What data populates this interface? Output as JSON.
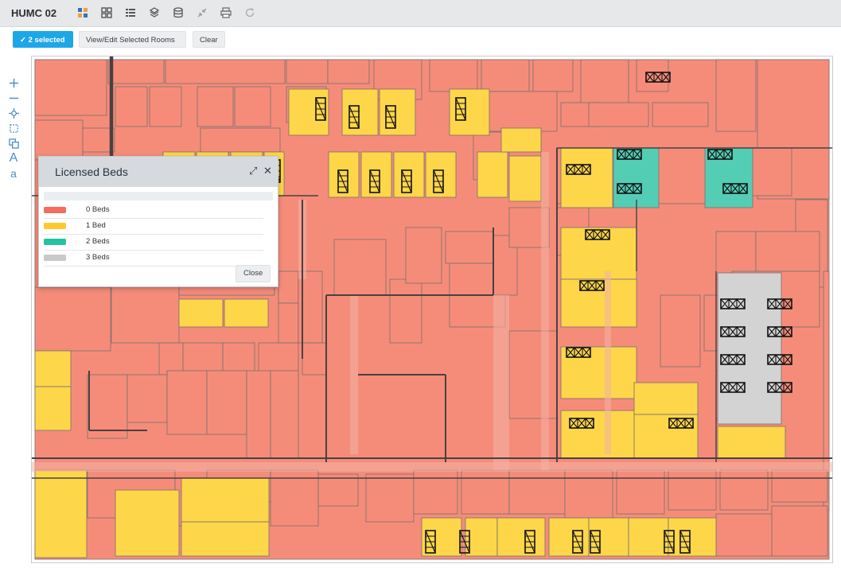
{
  "header": {
    "title": "HUMC 02"
  },
  "toolbar": {
    "icons": [
      "grid-color-icon",
      "grid-icon",
      "list-icon",
      "layers-icon",
      "stack-icon",
      "collapse-icon",
      "print-icon",
      "refresh-icon"
    ]
  },
  "actions": {
    "selected_label": "2 selected",
    "view_edit_label": "View/Edit Selected Rooms",
    "clear_label": "Clear"
  },
  "map_tools": [
    "zoom-in",
    "zoom-out",
    "pan",
    "select-area",
    "copy",
    "text-large",
    "text-small"
  ],
  "map_tool_glyphs": {
    "text_large": "A",
    "text_small": "a"
  },
  "legend": {
    "title": "Licensed Beds",
    "close_label": "Close",
    "items": [
      {
        "label": "0 Beds",
        "color": "#f26d5e"
      },
      {
        "label": "1 Bed",
        "color": "#fdc92e"
      },
      {
        "label": "2 Beds",
        "color": "#26c2a2"
      },
      {
        "label": "3 Beds",
        "color": "#c9c9c9"
      }
    ]
  },
  "colors": {
    "room_zero": "#f58c7a",
    "room_one": "#fdd64a",
    "room_two": "#54cdb5",
    "room_three": "#d3d3d3",
    "accent": "#1ea7e8"
  }
}
